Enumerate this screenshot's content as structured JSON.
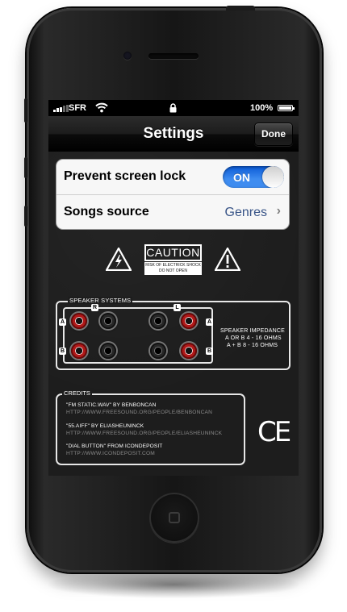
{
  "status_bar": {
    "carrier": "SFR",
    "battery": "100%",
    "icons": [
      "signal-icon",
      "wifi-icon",
      "lock-icon",
      "battery-icon"
    ]
  },
  "navbar": {
    "title": "Settings",
    "done_label": "Done"
  },
  "settings": {
    "prevent_lock_label": "Prevent screen lock",
    "toggle_state": "ON",
    "songs_source_label": "Songs source",
    "songs_source_value": "Genres"
  },
  "caution": {
    "title": "CAUTION",
    "line1": "RISK OF ELECTRICK SHOCK",
    "line2": "DO NOT OPEN"
  },
  "speaker": {
    "title": "SPEAKER SYSTEMS",
    "label_r": "R",
    "label_l": "L",
    "label_a": "A",
    "label_b": "B",
    "impedance_heading": "SPEAKER  IMPEDANCE",
    "impedance_row1": "A OR B  4 - 16 OHMS",
    "impedance_row2": "A + B  8 - 16 OHMS"
  },
  "credits": {
    "title": "CREDITS",
    "items": [
      {
        "name": "\"FM STATIC.WAV\" BY BENBONCAN",
        "url": "HTTP://WWW.FREESOUND.ORG/PEOPLE/BENBONCAN"
      },
      {
        "name": "\"55.AIFF\" BY ELIASHEUNINCK",
        "url": "HTTP://WWW.FREESOUND.ORG/PEOPLE/ELIASHEUNINCK"
      },
      {
        "name": "\"DIAL BUTTON\" FROM ICONDEPOSIT",
        "url": "HTTP://WWW.ICONDEPOSIT.COM"
      }
    ],
    "mark": "CE"
  },
  "colors": {
    "toggle_on": "#3e8cf0",
    "value_text": "#385487",
    "jack_red": "#b01818"
  }
}
